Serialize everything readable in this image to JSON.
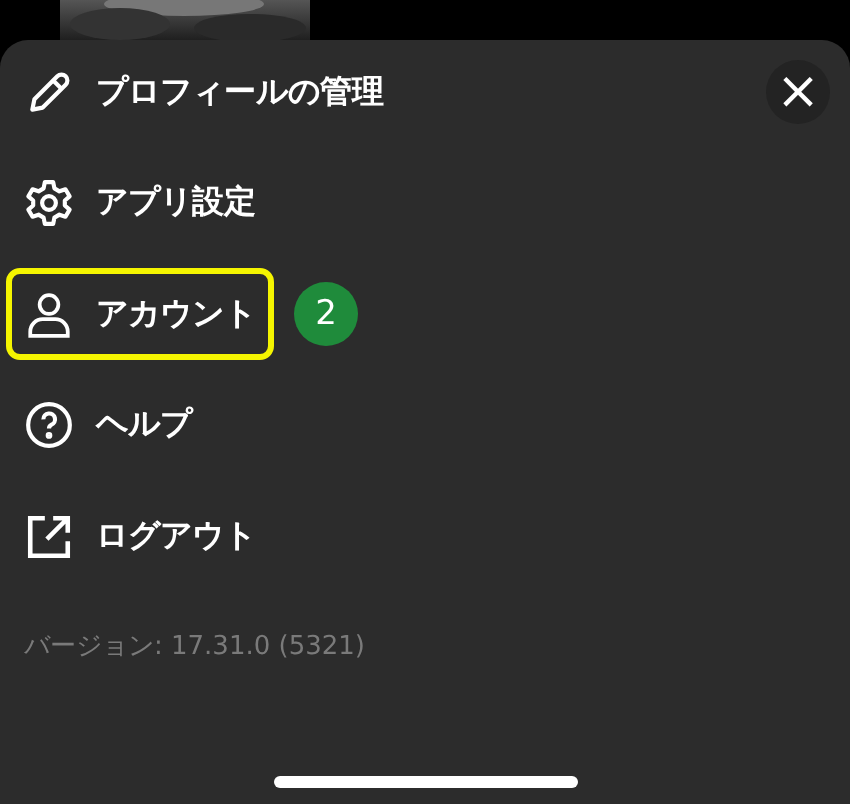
{
  "menu": {
    "close_label": "×",
    "items": [
      {
        "kind": "pencil",
        "label": "プロフィールの管理",
        "highlighted": false
      },
      {
        "kind": "gear",
        "label": "アプリ設定",
        "highlighted": false
      },
      {
        "kind": "person",
        "label": "アカウント",
        "highlighted": true,
        "badge": "2"
      },
      {
        "kind": "help",
        "label": "ヘルプ",
        "highlighted": false
      },
      {
        "kind": "external",
        "label": "ログアウト",
        "highlighted": false
      }
    ]
  },
  "version": "バージョン: 17.31.0 (5321)"
}
